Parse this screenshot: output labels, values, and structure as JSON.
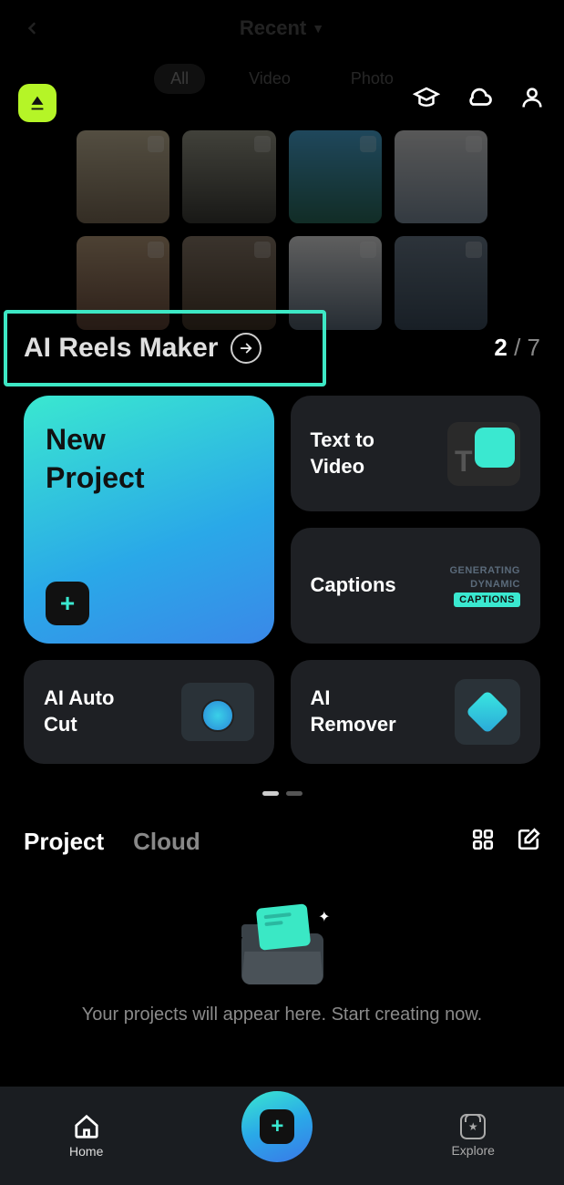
{
  "topbar": {
    "title": "Recent"
  },
  "filters": {
    "all": "All",
    "video": "Video",
    "photo": "Photo"
  },
  "aiReels": {
    "label": "AI Reels Maker"
  },
  "pagination": {
    "current": "2",
    "total": "7"
  },
  "cards": {
    "newProject": "New\nProject",
    "textToVideo": "Text to Video",
    "captions": {
      "title": "Captions",
      "l1": "GENERATING",
      "l2": "DYNAMIC",
      "l3": "CAPTIONS"
    },
    "aiAutoCut": "AI Auto Cut",
    "aiRemover": "AI Remover"
  },
  "projectTabs": {
    "project": "Project",
    "cloud": "Cloud"
  },
  "emptyState": {
    "text": "Your projects will appear here. Start creating now."
  },
  "nav": {
    "home": "Home",
    "explore": "Explore"
  }
}
